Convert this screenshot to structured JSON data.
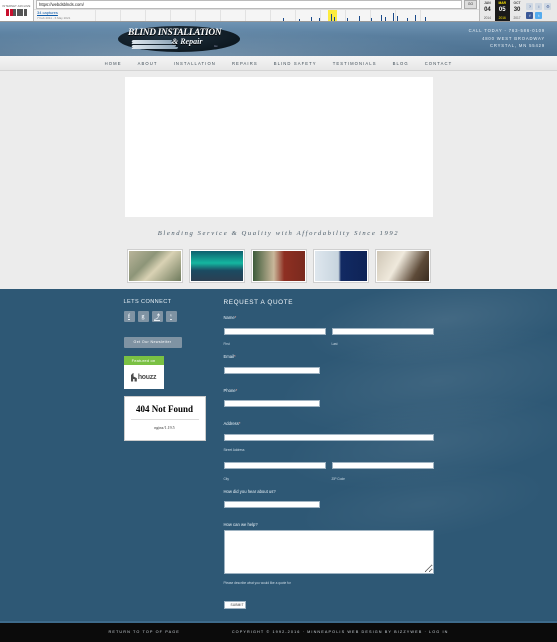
{
  "wayback": {
    "ia_label": "INTERNET ARCHIVE",
    "logo_alt": "wayback-machine-logo",
    "url": "https://webdsblnds.com/",
    "go_label": "GO",
    "captures": "34 captures",
    "date_range": "7 Feb 2011 - 6 May 2021",
    "months": [
      {
        "month": "JAN",
        "day": "04",
        "year": "2014",
        "selected": false
      },
      {
        "month": "MAR",
        "day": "05",
        "year": "2016",
        "selected": true
      },
      {
        "month": "OCT",
        "day": "30",
        "year": "2017",
        "selected": false
      }
    ],
    "icons": [
      "help-icon",
      "info-icon",
      "gear-icon",
      "facebook-icon",
      "twitter-icon"
    ]
  },
  "header": {
    "logo_line1": "BLIND INSTALLATION",
    "logo_line2": "& Repair",
    "logo_line3": "Inc.",
    "contact": [
      "CALL TODAY - 763-586-0109",
      "4800 WEST BROADWAY",
      "CRYSTAL, MN 55429"
    ]
  },
  "nav": {
    "items": [
      "HOME",
      "ABOUT",
      "INSTALLATION",
      "REPAIRS",
      "BLIND SAFETY",
      "TESTIMONIALS",
      "BLOG",
      "CONTACT"
    ]
  },
  "tagline": "Blending Service & Quality with Affordability Since 1992",
  "thumbnails": [
    {
      "name": "thumb-living-room-blinds"
    },
    {
      "name": "thumb-bedroom-view-blinds"
    },
    {
      "name": "thumb-vertical-blinds"
    },
    {
      "name": "thumb-office-blinds"
    },
    {
      "name": "thumb-patio-door-blinds"
    }
  ],
  "sidebar": {
    "connect_title": "LETS CONNECT",
    "socials": [
      {
        "name": "facebook-icon",
        "glyph": "f"
      },
      {
        "name": "google-plus-icon",
        "glyph": "g"
      },
      {
        "name": "rss-icon",
        "glyph": "⤴"
      },
      {
        "name": "twitter-icon",
        "glyph": "ᵛ"
      }
    ],
    "newsletter_label": "Get Our Newsletter",
    "houzz": {
      "featured_label": "Featured on",
      "brand": "houzz"
    },
    "error": {
      "title": "404 Not Found",
      "server": "nginx/1.19.5"
    }
  },
  "form": {
    "title": "REQUEST A QUOTE",
    "name_label": "Name",
    "name_required": "*",
    "first_sub": "First",
    "last_sub": "Last",
    "email_label": "Email",
    "email_required": "*",
    "phone_label": "Phone",
    "phone_required": "*",
    "address_label": "Address",
    "address_required": "*",
    "street_sub": "Street Address",
    "city_sub": "City",
    "zip_sub": "ZIP Code",
    "hear_label": "How did you hear about us?",
    "help_label": "How can we help?",
    "help_hint": "Please describe what you would like a quote for",
    "submit_label": "SUBMIT",
    "values": {
      "first": "",
      "last": "",
      "email": "",
      "phone": "",
      "street": "",
      "city": "",
      "zip": "",
      "hear": "",
      "message": ""
    }
  },
  "footer": {
    "top_link": "RETURN TO TOP OF PAGE",
    "copyright": "COPYRIGHT © 1992-2016 · MINNEAPOLIS WEB DESIGN BY BIZZYWEB · LOG IN"
  },
  "colors": {
    "blue_body": "#2e5875",
    "header_blue": "#5a7f9f",
    "houzz_green": "#7ac143",
    "footer_black": "#0b0b0b"
  }
}
